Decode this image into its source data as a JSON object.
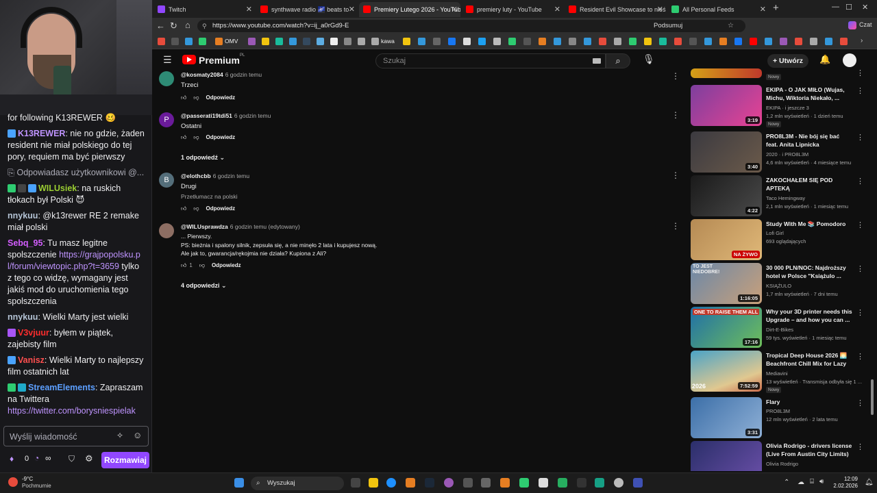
{
  "chat": {
    "messages": [
      {
        "user": "",
        "text": "for following K13REWER",
        "partial": true
      },
      {
        "user": "K13REWER",
        "text": ": nie no gdzie, żaden resident nie miał polskiego do tej pory, requiem ma być pierwszy",
        "user_color": "#bf94ff"
      },
      {
        "reply_info": "Odpowiadasz użytkownikowi @..."
      },
      {
        "user": "WILUsiek",
        "text": ": na ruskich tłokach był Polski",
        "user_color": "#9acd32"
      },
      {
        "user": "nnykuu",
        "text": ": @k13rewer RE 2 remake miał polski",
        "user_color": "#b5c4d6"
      },
      {
        "user": "Sebq_95",
        "text": ": Tu masz legitne spolszczenie",
        "link": "https://grajpopolsku.pl/forum/viewtopic.php?t=3659",
        "after": " tylko z tego co widzę, wymagany jest jakiś mod do uruchomienia tego spolszczenia",
        "user_color": "#d35eff"
      },
      {
        "user": "nnykuu",
        "text": ": Wielki Marty jest wielki",
        "user_color": "#b5c4d6"
      },
      {
        "user": "V3vjuur",
        "text": ": byłem w piątek, zajebisty film",
        "user_color": "#ff2d2d"
      },
      {
        "user": "Vanisz",
        "text": ": Wielki Marty to najlepszy film ostatnich lat",
        "user_color": "#ff4f4f"
      },
      {
        "user": "StreamElements",
        "text": ": Zapraszam na Twittera",
        "link": "https://twitter.com/borysniespielak",
        "user_color": "#5c9fff"
      }
    ],
    "input_placeholder": "Wyślij wiadomość",
    "points": "0",
    "infinity": "∞",
    "send_label": "Rozmawiaj"
  },
  "browser": {
    "tabs": [
      {
        "label": "Twitch",
        "color": "#9147ff"
      },
      {
        "label": "synthwave radio 🌌 beats to",
        "color": "#ff0000"
      },
      {
        "label": "Premiery Lutego 2026 - YouTube",
        "color": "#ff0000",
        "active": true
      },
      {
        "label": "premiery luty - YouTube",
        "color": "#ff0000"
      },
      {
        "label": "Resident Evil Showcase to nieśmie",
        "color": "#ff0000"
      },
      {
        "label": "All Personal Feeds",
        "color": "#2ecc71"
      }
    ],
    "url": "https://www.youtube.com/watch?v=ij_a0rGd9-E",
    "summarize_label": "Podsumuj",
    "chat_label": "Czat",
    "bookmark_label_omv": "OMV",
    "bookmark_label_kawa": "kawa"
  },
  "youtube": {
    "brand": "Premium",
    "brand_sup": "PL",
    "search_placeholder": "Szukaj",
    "create_label": "Utwórz",
    "comments": [
      {
        "author": "@kosmaty2084",
        "time": "6 godzin temu",
        "text": "Trzeci",
        "reply": "Odpowiedz"
      },
      {
        "author": "@passerati19tdi51",
        "time": "6 godzin temu",
        "text": "Ostatni",
        "reply": "Odpowiedz",
        "replies": "1 odpowiedź",
        "avatar_letter": "P"
      },
      {
        "author": "@elothcbb",
        "time": "6 godzin temu",
        "text": "Drugi",
        "translate": "Przetłumacz na polski",
        "reply": "Odpowiedz",
        "avatar_letter": "B"
      },
      {
        "author": "@WILUsprawdza",
        "time": "6 godzin temu (edytowany)",
        "lines": [
          "... Pierwszy.",
          "PS: bieżnia i spalony silnik, zepsuła się, a nie minęło 2 lata i kupujesz nową.",
          "Ale jak to, gwarancja/rękojmia nie działa? Kupiona z Ali?"
        ],
        "likes": "1",
        "reply": "Odpowiedz",
        "replies": "4 odpowiedzi"
      }
    ],
    "recommendations": [
      {
        "title": "EKIPA - O JAK MIŁO (Wujas, Michu, Wiktoria Niekało, ...",
        "channel": "EKIPA · i jeszcze 3",
        "meta": "1,2 mln wyświetleń · 1 dzień temu",
        "duration": "3:19",
        "badge": "Nowy",
        "thumb": "#7d3f9e"
      },
      {
        "title": "PRO8L3M - Nie bój się bać feat. Anita Lipnicka",
        "channel": "2020 · i PRO8L3M",
        "meta": "4,6 mln wyświetleń · 4 miesiące temu",
        "duration": "3:40",
        "thumb": "#3b3a40"
      },
      {
        "title": "ZAKOCHAŁEM SIĘ POD APTEKĄ",
        "channel": "Taco Hemingway",
        "meta": "2,1 mln wyświetleń · 1 miesiąc temu",
        "duration": "4:22",
        "thumb": "#2a2a2a"
      },
      {
        "title": "Study With Me 📚 Pomodoro",
        "channel": "Lofi Girl",
        "meta": "693 oglądających",
        "duration": "NA ŻYWO",
        "live": true,
        "thumb": "#b58a54"
      },
      {
        "title": "30 000 PLN/NOC: Najdroższy hotel w Polsce \"Książulo ...",
        "channel": "KSIĄŻULO",
        "meta": "1,7 mln wyświetleń · 7 dni temu",
        "duration": "1:16:05",
        "thumb": "#6b88a8",
        "overlay": "TO JEST NIEDOBRE!"
      },
      {
        "title": "Why your 3D printer needs this Upgrade – and how you can ...",
        "channel": "Dirt-E-Bikes",
        "meta": "59 tys. wyświetleń · 1 miesiąc temu",
        "duration": "17:16",
        "thumb": "#1f6fa8",
        "overlay": "ONE TO RAISE THEM ALL"
      },
      {
        "title": "Tropical Deep House 2026 🌅 Beachfront Chill Mix for Lazy ...",
        "channel": "Mediavini",
        "meta": "13 wyświetleń · Transmisja odbyła się 1 ...",
        "duration": "7:52:59",
        "badge": "Nowy",
        "thumb": "#4aa3c7",
        "overlay": "2026"
      },
      {
        "title": "Flary",
        "channel": "PRO8L3M",
        "meta": "12 mln wyświetleń · 2 lata temu",
        "duration": "3:31",
        "thumb": "#3c6fa8"
      },
      {
        "title": "Olivia Rodrigo - drivers license (Live From Austin City Limits)",
        "channel": "Olivia Rodrigo",
        "meta": "",
        "duration": "",
        "thumb": "#2b2f6a"
      }
    ],
    "top_rec_badge": "Nowy"
  },
  "taskbar": {
    "temp": "-9°C",
    "weather": "Pochmurnie",
    "search": "Wyszukaj",
    "time": "12:09",
    "date": "2.02.2026"
  }
}
